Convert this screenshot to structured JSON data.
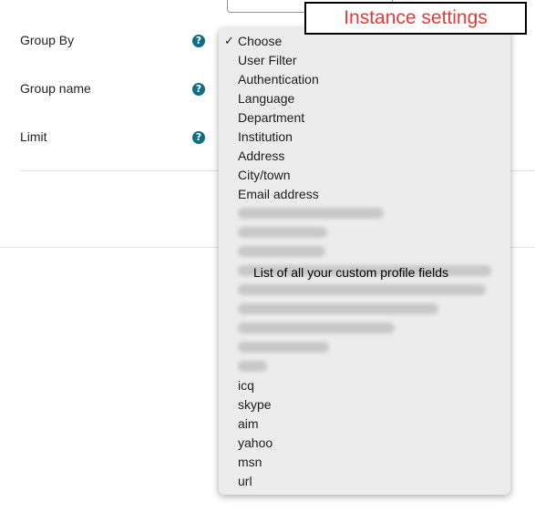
{
  "form": {
    "fields": [
      {
        "label": "Group By"
      },
      {
        "label": "Group name"
      },
      {
        "label": "Limit"
      }
    ],
    "help_icon_glyph": "?"
  },
  "dropdown": {
    "check_glyph": "✓",
    "selected": "Choose",
    "options_top": [
      "Choose",
      "User Filter",
      "Authentication",
      "Language",
      "Department",
      "Institution",
      "Address",
      "City/town",
      "Email address"
    ],
    "blurred_count": 9,
    "options_bottom": [
      "icq",
      "skype",
      "aim",
      "yahoo",
      "msn",
      "url"
    ]
  },
  "annotations": {
    "custom_fields_note": "List of all your custom profile fields",
    "callout": "Instance settings",
    "callout_color": "#e8383a"
  },
  "colors": {
    "help_icon": "#0f6e84",
    "dropdown_bg": "#ececec"
  },
  "icons": {
    "help": "question-circle-icon",
    "check": "checkmark-icon"
  }
}
